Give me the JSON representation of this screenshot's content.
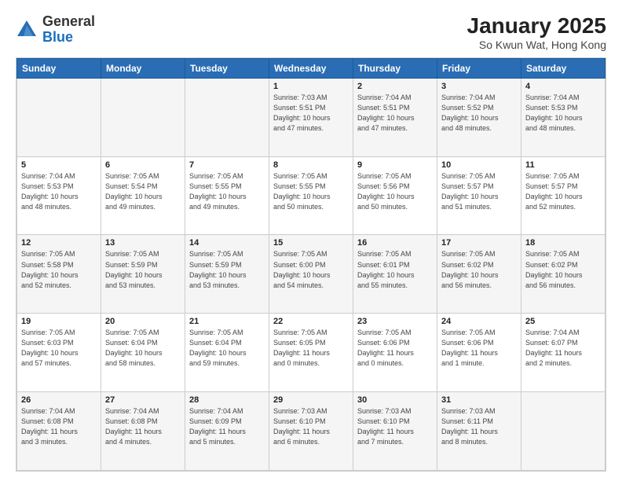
{
  "header": {
    "logo_general": "General",
    "logo_blue": "Blue",
    "title": "January 2025",
    "subtitle": "So Kwun Wat, Hong Kong"
  },
  "weekdays": [
    "Sunday",
    "Monday",
    "Tuesday",
    "Wednesday",
    "Thursday",
    "Friday",
    "Saturday"
  ],
  "weeks": [
    [
      {
        "day": "",
        "info": ""
      },
      {
        "day": "",
        "info": ""
      },
      {
        "day": "",
        "info": ""
      },
      {
        "day": "1",
        "info": "Sunrise: 7:03 AM\nSunset: 5:51 PM\nDaylight: 10 hours\nand 47 minutes."
      },
      {
        "day": "2",
        "info": "Sunrise: 7:04 AM\nSunset: 5:51 PM\nDaylight: 10 hours\nand 47 minutes."
      },
      {
        "day": "3",
        "info": "Sunrise: 7:04 AM\nSunset: 5:52 PM\nDaylight: 10 hours\nand 48 minutes."
      },
      {
        "day": "4",
        "info": "Sunrise: 7:04 AM\nSunset: 5:53 PM\nDaylight: 10 hours\nand 48 minutes."
      }
    ],
    [
      {
        "day": "5",
        "info": "Sunrise: 7:04 AM\nSunset: 5:53 PM\nDaylight: 10 hours\nand 48 minutes."
      },
      {
        "day": "6",
        "info": "Sunrise: 7:05 AM\nSunset: 5:54 PM\nDaylight: 10 hours\nand 49 minutes."
      },
      {
        "day": "7",
        "info": "Sunrise: 7:05 AM\nSunset: 5:55 PM\nDaylight: 10 hours\nand 49 minutes."
      },
      {
        "day": "8",
        "info": "Sunrise: 7:05 AM\nSunset: 5:55 PM\nDaylight: 10 hours\nand 50 minutes."
      },
      {
        "day": "9",
        "info": "Sunrise: 7:05 AM\nSunset: 5:56 PM\nDaylight: 10 hours\nand 50 minutes."
      },
      {
        "day": "10",
        "info": "Sunrise: 7:05 AM\nSunset: 5:57 PM\nDaylight: 10 hours\nand 51 minutes."
      },
      {
        "day": "11",
        "info": "Sunrise: 7:05 AM\nSunset: 5:57 PM\nDaylight: 10 hours\nand 52 minutes."
      }
    ],
    [
      {
        "day": "12",
        "info": "Sunrise: 7:05 AM\nSunset: 5:58 PM\nDaylight: 10 hours\nand 52 minutes."
      },
      {
        "day": "13",
        "info": "Sunrise: 7:05 AM\nSunset: 5:59 PM\nDaylight: 10 hours\nand 53 minutes."
      },
      {
        "day": "14",
        "info": "Sunrise: 7:05 AM\nSunset: 5:59 PM\nDaylight: 10 hours\nand 53 minutes."
      },
      {
        "day": "15",
        "info": "Sunrise: 7:05 AM\nSunset: 6:00 PM\nDaylight: 10 hours\nand 54 minutes."
      },
      {
        "day": "16",
        "info": "Sunrise: 7:05 AM\nSunset: 6:01 PM\nDaylight: 10 hours\nand 55 minutes."
      },
      {
        "day": "17",
        "info": "Sunrise: 7:05 AM\nSunset: 6:02 PM\nDaylight: 10 hours\nand 56 minutes."
      },
      {
        "day": "18",
        "info": "Sunrise: 7:05 AM\nSunset: 6:02 PM\nDaylight: 10 hours\nand 56 minutes."
      }
    ],
    [
      {
        "day": "19",
        "info": "Sunrise: 7:05 AM\nSunset: 6:03 PM\nDaylight: 10 hours\nand 57 minutes."
      },
      {
        "day": "20",
        "info": "Sunrise: 7:05 AM\nSunset: 6:04 PM\nDaylight: 10 hours\nand 58 minutes."
      },
      {
        "day": "21",
        "info": "Sunrise: 7:05 AM\nSunset: 6:04 PM\nDaylight: 10 hours\nand 59 minutes."
      },
      {
        "day": "22",
        "info": "Sunrise: 7:05 AM\nSunset: 6:05 PM\nDaylight: 11 hours\nand 0 minutes."
      },
      {
        "day": "23",
        "info": "Sunrise: 7:05 AM\nSunset: 6:06 PM\nDaylight: 11 hours\nand 0 minutes."
      },
      {
        "day": "24",
        "info": "Sunrise: 7:05 AM\nSunset: 6:06 PM\nDaylight: 11 hours\nand 1 minute."
      },
      {
        "day": "25",
        "info": "Sunrise: 7:04 AM\nSunset: 6:07 PM\nDaylight: 11 hours\nand 2 minutes."
      }
    ],
    [
      {
        "day": "26",
        "info": "Sunrise: 7:04 AM\nSunset: 6:08 PM\nDaylight: 11 hours\nand 3 minutes."
      },
      {
        "day": "27",
        "info": "Sunrise: 7:04 AM\nSunset: 6:08 PM\nDaylight: 11 hours\nand 4 minutes."
      },
      {
        "day": "28",
        "info": "Sunrise: 7:04 AM\nSunset: 6:09 PM\nDaylight: 11 hours\nand 5 minutes."
      },
      {
        "day": "29",
        "info": "Sunrise: 7:03 AM\nSunset: 6:10 PM\nDaylight: 11 hours\nand 6 minutes."
      },
      {
        "day": "30",
        "info": "Sunrise: 7:03 AM\nSunset: 6:10 PM\nDaylight: 11 hours\nand 7 minutes."
      },
      {
        "day": "31",
        "info": "Sunrise: 7:03 AM\nSunset: 6:11 PM\nDaylight: 11 hours\nand 8 minutes."
      },
      {
        "day": "",
        "info": ""
      }
    ]
  ]
}
